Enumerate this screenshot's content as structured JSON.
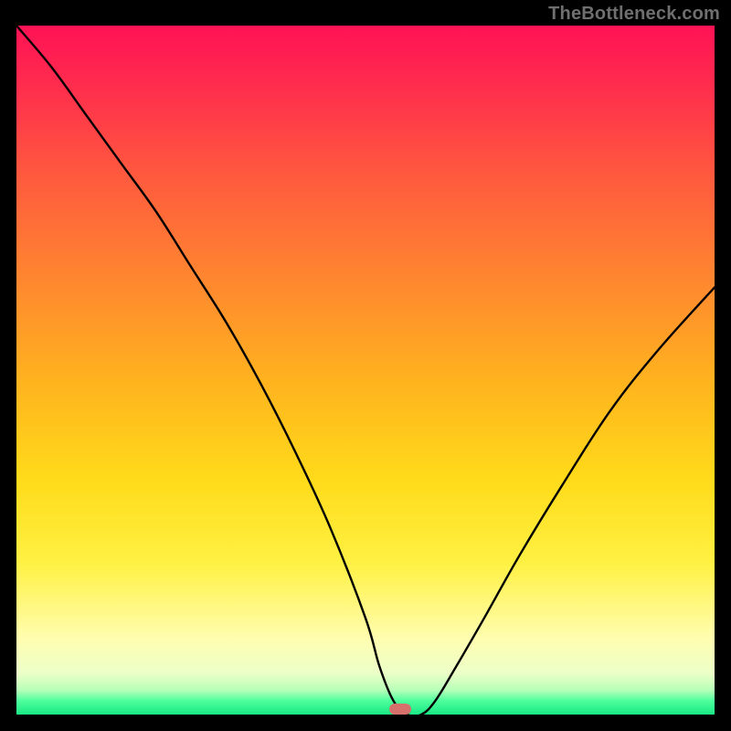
{
  "attribution": "TheBottleneck.com",
  "chart_data": {
    "type": "line",
    "title": "",
    "xlabel": "",
    "ylabel": "",
    "xlim": [
      0,
      100
    ],
    "ylim": [
      0,
      100
    ],
    "series": [
      {
        "name": "curve",
        "x": [
          0,
          5,
          10,
          15,
          20,
          25,
          30,
          35,
          40,
          45,
          50,
          52,
          54,
          56,
          58,
          60,
          63,
          67,
          72,
          78,
          85,
          92,
          100
        ],
        "values": [
          100,
          94,
          87,
          80,
          73,
          65,
          57,
          48,
          38,
          27,
          14,
          7,
          2,
          0,
          0,
          2,
          7,
          14,
          23,
          33,
          44,
          53,
          62
        ]
      }
    ],
    "marker": {
      "x": 55,
      "y": 0.8
    },
    "background": {
      "type": "vertical-gradient",
      "stops": [
        {
          "pct": 0,
          "color": "#ff1254"
        },
        {
          "pct": 22,
          "color": "#ff5a3e"
        },
        {
          "pct": 52,
          "color": "#ffb41e"
        },
        {
          "pct": 78,
          "color": "#fff143"
        },
        {
          "pct": 94,
          "color": "#ecffc8"
        },
        {
          "pct": 100,
          "color": "#18e884"
        }
      ]
    }
  }
}
